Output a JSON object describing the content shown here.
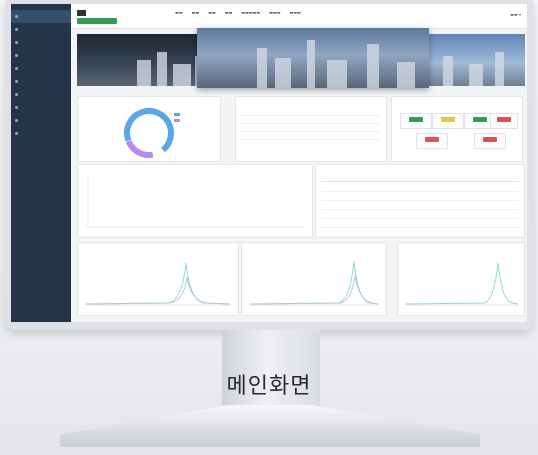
{
  "caption": "메인화면",
  "donut": {
    "colors": [
      "#5aa7e8",
      "#b58cf0"
    ]
  },
  "colors": {
    "sidebar": "#26344a",
    "badge": "#2f9e5a",
    "line_chart": "#8fd9d0",
    "tag_green": "#2f9e5a",
    "tag_red": "#d9534f",
    "tag_yellow": "#e9c44b"
  }
}
